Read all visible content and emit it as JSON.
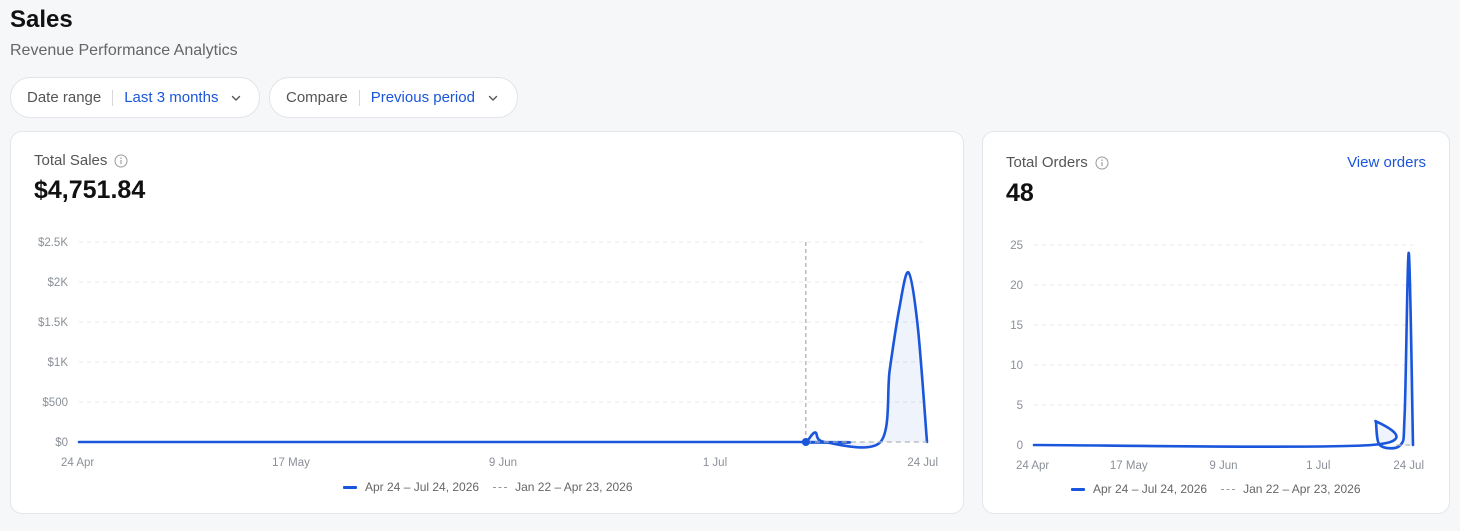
{
  "header": {
    "title": "Sales",
    "subtitle": "Revenue Performance Analytics"
  },
  "filters": {
    "date_range": {
      "label": "Date range",
      "value": "Last 3 months",
      "icon": "chevron-down-icon"
    },
    "compare": {
      "label": "Compare",
      "value": "Previous period",
      "icon": "chevron-down-icon"
    }
  },
  "sales_card": {
    "label": "Total Sales",
    "value": "$4,751.84",
    "info_icon": "info-icon"
  },
  "orders_card": {
    "label": "Total Orders",
    "value": "48",
    "link": "View orders",
    "info_icon": "info-icon"
  },
  "legend": {
    "current": "Apr 24 – Jul 24, 2026",
    "previous": "Jan 22 – Apr 23, 2026"
  },
  "colors": {
    "accent": "#1a56db",
    "grid": "#e6e8eb",
    "muted_text": "#8a8f98"
  },
  "chart_data": [
    {
      "type": "line",
      "title": "Total Sales",
      "x_ticks": [
        "24 Apr",
        "17 May",
        "9 Jun",
        "1 Jul",
        "24 Jul"
      ],
      "y_ticks": [
        "$0",
        "$500",
        "$1K",
        "$1.5K",
        "$2K",
        "$2.5K"
      ],
      "ylim": [
        0,
        2500
      ],
      "grid": true,
      "legend": "bottom",
      "series": [
        {
          "name": "Apr 24 – Jul 24, 2026",
          "style": "solid",
          "points": [
            [
              "2026-04-24",
              0
            ],
            [
              "2026-07-10",
              0
            ],
            [
              "2026-07-11",
              0
            ],
            [
              "2026-07-12",
              120
            ],
            [
              "2026-07-13",
              0
            ],
            [
              "2026-07-19",
              0
            ],
            [
              "2026-07-20",
              900
            ],
            [
              "2026-07-21",
              1650
            ],
            [
              "2026-07-22",
              2120
            ],
            [
              "2026-07-23",
              1450
            ],
            [
              "2026-07-24",
              0
            ]
          ]
        },
        {
          "name": "Jan 22 – Apr 23, 2026",
          "style": "dashed",
          "points": [
            [
              "2026-07-11",
              0
            ],
            [
              "2026-07-24",
              0
            ]
          ]
        }
      ],
      "hover_date": "2026-07-11"
    },
    {
      "type": "line",
      "title": "Total Orders",
      "x_ticks": [
        "24 Apr",
        "17 May",
        "9 Jun",
        "1 Jul",
        "24 Jul"
      ],
      "y_ticks": [
        "0",
        "5",
        "10",
        "15",
        "20",
        "25"
      ],
      "ylim": [
        0,
        25
      ],
      "grid": true,
      "legend": "bottom",
      "series": [
        {
          "name": "Apr 24 – Jul 24, 2026",
          "style": "solid",
          "points": [
            [
              "2026-04-24",
              0
            ],
            [
              "2026-07-14",
              0
            ],
            [
              "2026-07-15",
              3
            ],
            [
              "2026-07-16",
              0
            ],
            [
              "2026-07-21",
              0
            ],
            [
              "2026-07-22",
              4
            ],
            [
              "2026-07-23",
              24
            ],
            [
              "2026-07-24",
              0
            ]
          ]
        },
        {
          "name": "Jan 22 – Apr 23, 2026",
          "style": "dashed",
          "points": [
            [
              "2026-07-20",
              0
            ],
            [
              "2026-07-24",
              0
            ]
          ]
        }
      ]
    }
  ]
}
